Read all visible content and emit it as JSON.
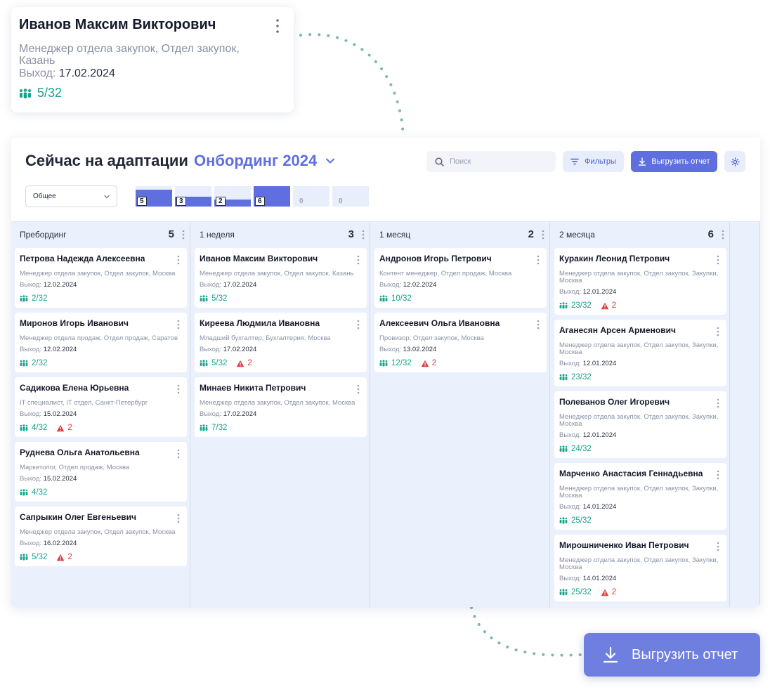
{
  "zoom_card": {
    "name": "Иванов Максим Викторович",
    "role": "Менеджер отдела закупок, Отдел закупок, Казань",
    "exit_label": "Выход:",
    "exit_date": "17.02.2024",
    "progress": "5/32"
  },
  "header": {
    "title": "Сейчас на адаптации",
    "project": "Онбординг 2024",
    "search_placeholder": "Поиск",
    "filter_label": "Фильтры",
    "export_label": "Выгрузить отчет",
    "select_value": "Общее"
  },
  "mini_chart": {
    "values": [
      5,
      3,
      2,
      6,
      0,
      0
    ],
    "labels": [
      "5",
      "3",
      "2",
      "6",
      "0",
      "0"
    ]
  },
  "columns": [
    {
      "name": "Пребординг",
      "count": "5",
      "cards": [
        {
          "name": "Петрова Надежда Алексеевна",
          "role": "Менеджер отдела закупок, Отдел закупок, Москва",
          "exit_label": "Выход:",
          "exit_date": "12.02.2024",
          "progress": "2/32",
          "warnings": ""
        },
        {
          "name": "Миронов Игорь Иванович",
          "role": "Менеджер отдела продаж, Отдел продаж, Саратов",
          "exit_label": "Выход:",
          "exit_date": "12.02.2024",
          "progress": "2/32",
          "warnings": ""
        },
        {
          "name": "Садикова Елена Юрьевна",
          "role": "IT специалист, IT отдел, Санкт-Петербург",
          "exit_label": "Выход:",
          "exit_date": "15.02.2024",
          "progress": "4/32",
          "warnings": "2"
        },
        {
          "name": "Руднева Ольга Анатольевна",
          "role": "Маркетолог, Отдел продаж, Москва",
          "exit_label": "Выход:",
          "exit_date": "15.02.2024",
          "progress": "4/32",
          "warnings": ""
        },
        {
          "name": "Сапрыкин Олег Евгеньевич",
          "role": "Менеджер отдела закупок, Отдел закупок, Москва",
          "exit_label": "Выход:",
          "exit_date": "16.02.2024",
          "progress": "5/32",
          "warnings": "2"
        }
      ]
    },
    {
      "name": "1 неделя",
      "count": "3",
      "cards": [
        {
          "name": "Иванов Максим Викторович",
          "role": "Менеджер отдела закупок, Отдел закупок, Казань",
          "exit_label": "Выход:",
          "exit_date": "17.02.2024",
          "progress": "5/32",
          "warnings": ""
        },
        {
          "name": "Киреева Людмила Ивановна",
          "role": "Младший бухгалтер, Бухгалтерия, Москва",
          "exit_label": "Выход:",
          "exit_date": "17.02.2024",
          "progress": "5/32",
          "warnings": "2"
        },
        {
          "name": "Минаев Никита Петрович",
          "role": "Менеджер отдела закупок, Отдел закупок, Москва",
          "exit_label": "Выход:",
          "exit_date": "17.02.2024",
          "progress": "7/32",
          "warnings": ""
        }
      ]
    },
    {
      "name": "1 месяц",
      "count": "2",
      "cards": [
        {
          "name": "Андронов Игорь Петрович",
          "role": "Контент менеджер, Отдел продаж, Москва",
          "exit_label": "Выход:",
          "exit_date": "12.02.2024",
          "progress": "10/32",
          "warnings": ""
        },
        {
          "name": "Алексеевич Ольга Ивановна",
          "role": "Провизор, Отдел закупок, Москва",
          "exit_label": "Выход:",
          "exit_date": "13.02.2024",
          "progress": "12/32",
          "warnings": "2"
        }
      ]
    },
    {
      "name": "2 месяца",
      "count": "6",
      "cards": [
        {
          "name": "Куракин Леонид Петрович",
          "role": "Менеджер отдела закупок, Отдел закупок, Закупки, Москва",
          "exit_label": "Выход:",
          "exit_date": "12.01.2024",
          "progress": "23/32",
          "warnings": "2"
        },
        {
          "name": "Аганесян Арсен Арменович",
          "role": "Менеджер отдела закупок, Отдел закупок, Закупки, Москва",
          "exit_label": "Выход:",
          "exit_date": "12.01.2024",
          "progress": "23/32",
          "warnings": ""
        },
        {
          "name": "Полеванов Олег Игоревич",
          "role": "Менеджер отдела закупок, Отдел закупок, Закупки, Москва",
          "exit_label": "Выход:",
          "exit_date": "12.01.2024",
          "progress": "24/32",
          "warnings": ""
        },
        {
          "name": "Марченко Анастасия Геннадьевна",
          "role": "Менеджер отдела закупок, Отдел закупок, Закупки, Москва",
          "exit_label": "Выход:",
          "exit_date": "14.01.2024",
          "progress": "25/32",
          "warnings": ""
        },
        {
          "name": "Мирошниченко Иван Петрович",
          "role": "Менеджер отдела закупок, Отдел закупок, Закупки, Москва",
          "exit_label": "Выход:",
          "exit_date": "14.01.2024",
          "progress": "25/32",
          "warnings": "2"
        }
      ]
    }
  ],
  "big_export": {
    "label": "Выгрузить отчет"
  },
  "colors": {
    "accent": "#5f6fe0",
    "progress": "#1ba28e",
    "warning": "#e03b3b",
    "board_bg": "#eaf0fc"
  },
  "icons": {
    "people": "people-icon",
    "warning": "warning-icon",
    "download": "download-icon",
    "search": "search-icon",
    "filter": "filter-icon",
    "settings": "gear-icon",
    "kebab": "kebab-icon",
    "chevron": "chevron-down-icon"
  }
}
